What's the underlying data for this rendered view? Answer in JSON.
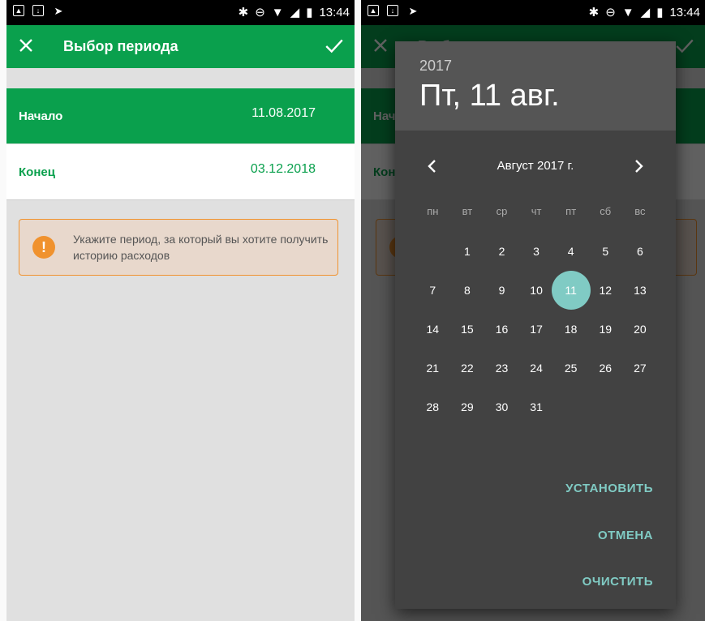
{
  "status": {
    "time": "13:44"
  },
  "appbar": {
    "title": "Выбор периода"
  },
  "period": {
    "start_label": "Начало",
    "start_value": "11.08.2017",
    "end_label": "Конец",
    "end_value": "03.12.2018",
    "warning": "Укажите период, за который вы хотите получить историю расходов"
  },
  "picker": {
    "year": "2017",
    "date": "Пт, 11 авг.",
    "month_label": "Август 2017 г.",
    "weekdays": [
      "пн",
      "вт",
      "ср",
      "чт",
      "пт",
      "сб",
      "вс"
    ],
    "weeks": [
      [
        "",
        "1",
        "2",
        "3",
        "4",
        "5",
        "6"
      ],
      [
        "7",
        "8",
        "9",
        "10",
        "11",
        "12",
        "13"
      ],
      [
        "14",
        "15",
        "16",
        "17",
        "18",
        "19",
        "20"
      ],
      [
        "21",
        "22",
        "23",
        "24",
        "25",
        "26",
        "27"
      ],
      [
        "28",
        "29",
        "30",
        "31",
        "",
        "",
        ""
      ]
    ],
    "selected_day": "11",
    "actions": {
      "set": "УСТАНОВИТЬ",
      "cancel": "ОТМЕНА",
      "clear": "ОЧИСТИТЬ"
    }
  },
  "colors": {
    "brand": "#0aa04d",
    "accent": "#80cbc4",
    "warning": "#f0922e"
  }
}
